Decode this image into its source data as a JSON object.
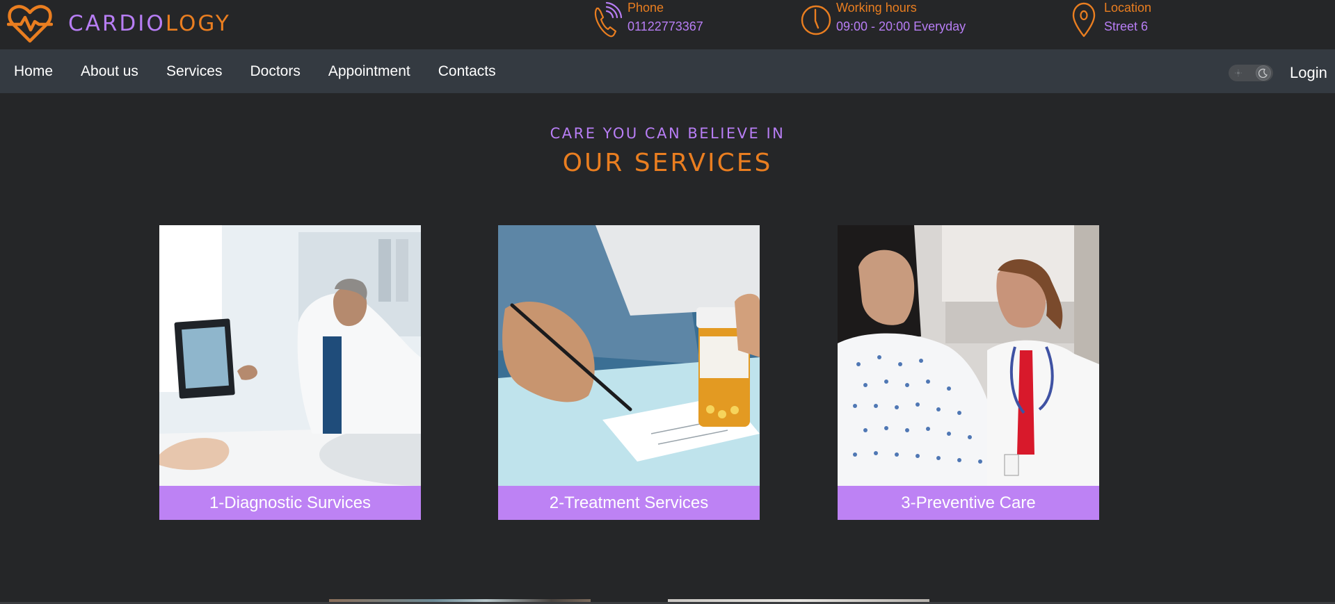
{
  "brand": {
    "name_part1": "CARDIO",
    "name_part2": "LOGY",
    "primary_color": "#b87ef5",
    "accent_color": "#ea7e20"
  },
  "contact": {
    "phone": {
      "label": "Phone",
      "value": "01122773367",
      "icon": "phone-icon"
    },
    "hours": {
      "label": "Working hours",
      "value": "09:00 - 20:00 Everyday",
      "icon": "clock-icon"
    },
    "location": {
      "label": "Location",
      "value": "Street 6",
      "icon": "location-pin-icon"
    }
  },
  "nav": {
    "items": [
      "Home",
      "About us",
      "Services",
      "Doctors",
      "Appointment",
      "Contacts"
    ],
    "login": "Login",
    "theme_toggle": {
      "state": "dark",
      "icons": [
        "sun-icon",
        "moon-icon"
      ]
    }
  },
  "section": {
    "subheading": "CARE YOU CAN BELIEVE IN",
    "heading": "OUR SERVICES"
  },
  "services": [
    {
      "caption": "1-Diagnostic Survices"
    },
    {
      "caption": "2-Treatment Services"
    },
    {
      "caption": "3-Preventive Care"
    }
  ]
}
